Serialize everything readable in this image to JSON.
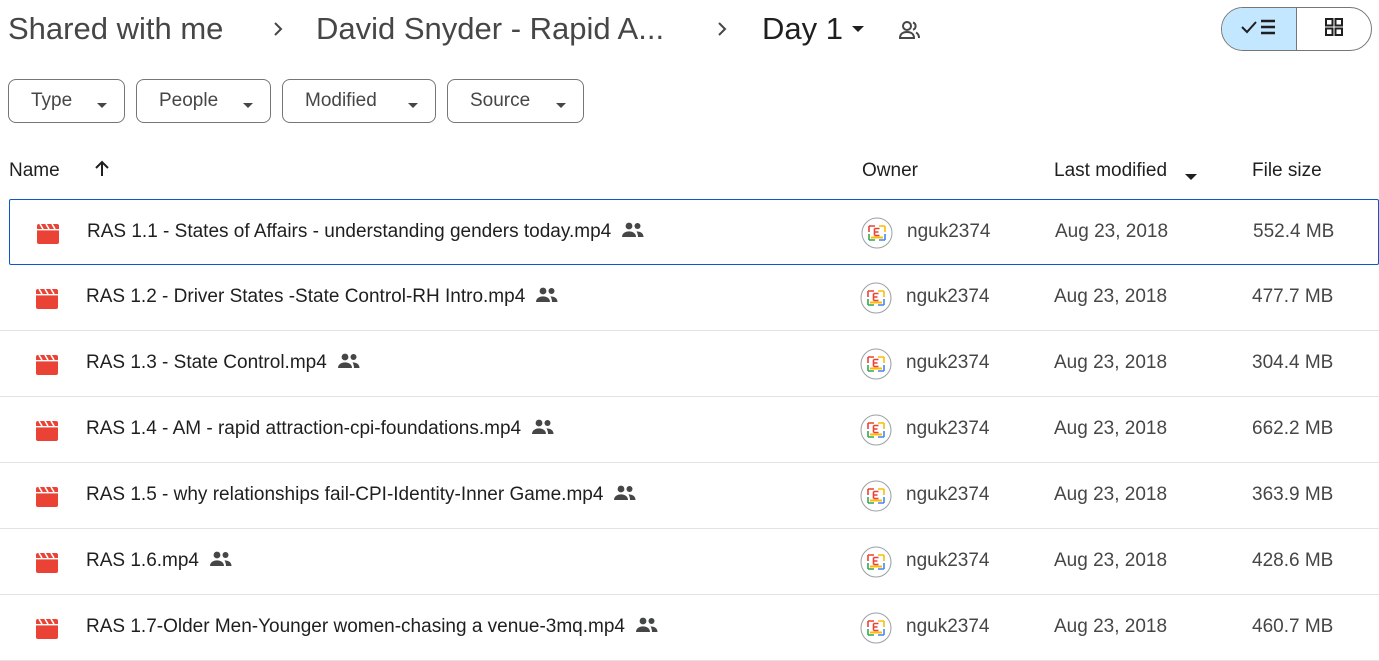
{
  "breadcrumb": {
    "root": "Shared with me",
    "parent": "David Snyder - Rapid A...",
    "current": "Day 1"
  },
  "filters": [
    {
      "label": "Type"
    },
    {
      "label": "People"
    },
    {
      "label": "Modified"
    },
    {
      "label": "Source"
    }
  ],
  "columns": {
    "name": "Name",
    "owner": "Owner",
    "last_modified": "Last modified",
    "file_size": "File size"
  },
  "files": [
    {
      "name": "RAS 1.1 - States of Affairs - understanding genders today.mp4",
      "owner": "nguk2374",
      "modified": "Aug 23, 2018",
      "size": "552.4 MB",
      "selected": true
    },
    {
      "name": "RAS 1.2 - Driver States -State Control-RH Intro.mp4",
      "owner": "nguk2374",
      "modified": "Aug 23, 2018",
      "size": "477.7 MB"
    },
    {
      "name": "RAS 1.3 - State Control.mp4",
      "owner": "nguk2374",
      "modified": "Aug 23, 2018",
      "size": "304.4 MB"
    },
    {
      "name": "RAS 1.4 - AM - rapid attraction-cpi-foundations.mp4",
      "owner": "nguk2374",
      "modified": "Aug 23, 2018",
      "size": "662.2 MB"
    },
    {
      "name": "RAS 1.5 - why relationships fail-CPI-Identity-Inner Game.mp4",
      "owner": "nguk2374",
      "modified": "Aug 23, 2018",
      "size": "363.9 MB"
    },
    {
      "name": "RAS 1.6.mp4",
      "owner": "nguk2374",
      "modified": "Aug 23, 2018",
      "size": "428.6 MB"
    },
    {
      "name": "RAS 1.7-Older Men-Younger women-chasing a venue-3mq.mp4",
      "owner": "nguk2374",
      "modified": "Aug 23, 2018",
      "size": "460.7 MB"
    }
  ],
  "icons": {
    "file": "video-file-icon",
    "shared": "people-icon",
    "accent": "#c2e7ff",
    "video_color": "#ea4335"
  }
}
